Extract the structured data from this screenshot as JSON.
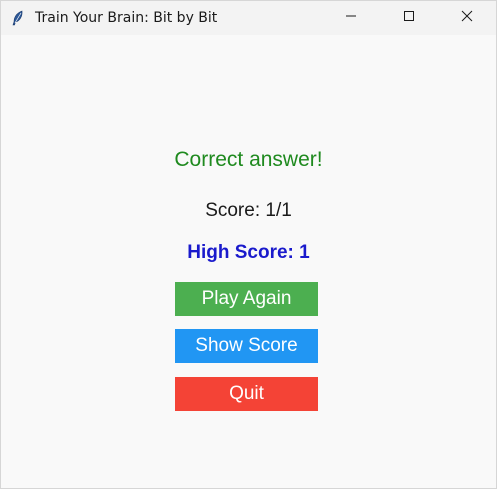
{
  "window": {
    "title": "Train Your Brain: Bit by Bit",
    "icon": "feather-icon",
    "controls": [
      "minimize-icon",
      "maximize-icon",
      "close-icon"
    ]
  },
  "game": {
    "status_text": "Correct answer!",
    "score_text": "Score: 1/1",
    "high_score_text": "High Score: 1"
  },
  "buttons": {
    "play_again": "Play Again",
    "show_score": "Show Score",
    "quit": "Quit"
  },
  "colors": {
    "status": "#1f8a1f",
    "high_score": "#1a1acc",
    "play_again": "#4caf50",
    "show_score": "#2196f3",
    "quit": "#f44336"
  }
}
